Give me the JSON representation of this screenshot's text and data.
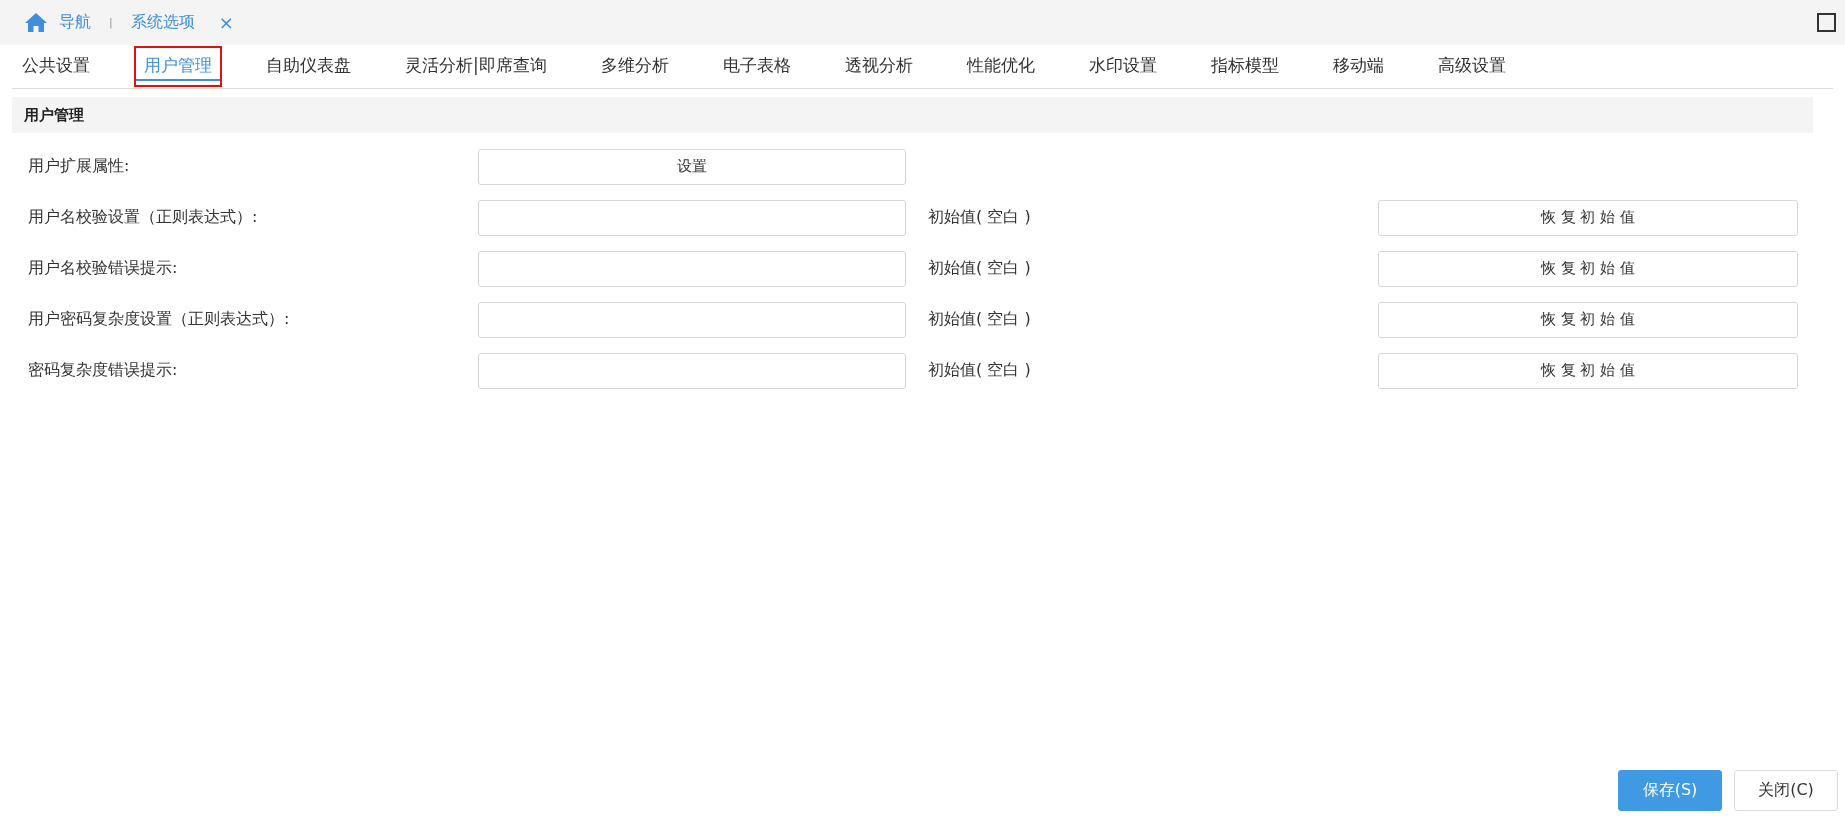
{
  "breadcrumb": {
    "home": "导航",
    "separator": "|",
    "current": "系统选项",
    "close": "×"
  },
  "tabs": [
    {
      "label": "公共设置",
      "selected": false
    },
    {
      "label": "用户管理",
      "selected": true
    },
    {
      "label": "自助仪表盘",
      "selected": false
    },
    {
      "label": "灵活分析|即席查询",
      "selected": false
    },
    {
      "label": "多维分析",
      "selected": false
    },
    {
      "label": "电子表格",
      "selected": false
    },
    {
      "label": "透视分析",
      "selected": false
    },
    {
      "label": "性能优化",
      "selected": false
    },
    {
      "label": "水印设置",
      "selected": false
    },
    {
      "label": "指标模型",
      "selected": false
    },
    {
      "label": "移动端",
      "selected": false
    },
    {
      "label": "高级设置",
      "selected": false
    }
  ],
  "section": {
    "title": "用户管理"
  },
  "rows": [
    {
      "kind": "button",
      "label": "用户扩展属性:",
      "button": "设置"
    },
    {
      "kind": "field",
      "label": "用户名校验设置（正则表达式）:",
      "initial": "初始值( 空白 )",
      "restore": "恢 复 初 始 值"
    },
    {
      "kind": "field",
      "label": "用户名校验错误提示:",
      "initial": "初始值( 空白 )",
      "restore": "恢 复 初 始 值"
    },
    {
      "kind": "field",
      "label": "用户密码复杂度设置（正则表达式）:",
      "initial": "初始值( 空白 )",
      "restore": "恢 复 初 始 值"
    },
    {
      "kind": "field",
      "label": "密码复杂度错误提示:",
      "initial": "初始值( 空白 )",
      "restore": "恢 复 初 始 值"
    }
  ],
  "footer": [
    {
      "kind": "primary",
      "label": "保存(S)"
    },
    {
      "kind": "default",
      "label": "关闭(C)"
    }
  ]
}
